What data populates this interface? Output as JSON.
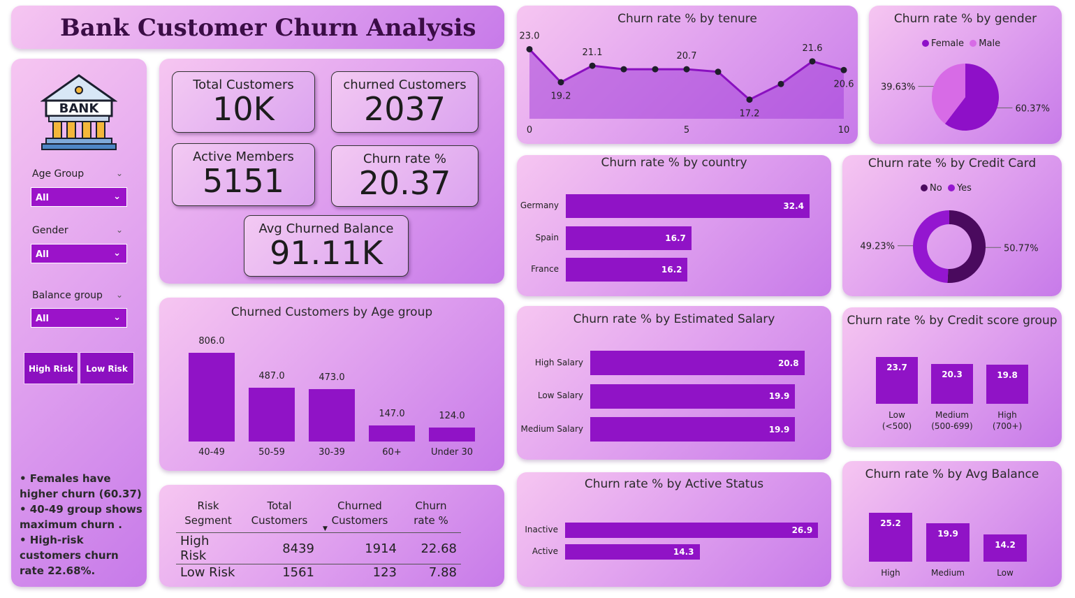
{
  "header": {
    "title": "Bank Customer Churn Analysis"
  },
  "logo": {
    "text": "BANK"
  },
  "slicers": [
    {
      "label": "Age Group",
      "value": "All"
    },
    {
      "label": "Gender",
      "value": "All"
    },
    {
      "label": "Balance group",
      "value": "All"
    }
  ],
  "risk_buttons": {
    "high": "High Risk",
    "low": "Low Risk"
  },
  "insights": [
    "• Females have higher churn (60.37)",
    "• 40-49 group shows maximum churn .",
    "• High-risk customers churn rate 22.68%."
  ],
  "kpis": {
    "total_customers": {
      "label": "Total Customers",
      "value": "10K"
    },
    "churned_customers": {
      "label": "churned Customers",
      "value": "2037"
    },
    "active_members": {
      "label": "Active Members",
      "value": "5151"
    },
    "churn_rate": {
      "label": "Churn rate %",
      "value": "20.37"
    },
    "avg_churned_balance": {
      "label": "Avg Churned Balance",
      "value": "91.11K"
    }
  },
  "risk_table": {
    "columns": [
      "Risk Segment",
      "Total Customers",
      "Churned Customers",
      "Churn rate %"
    ],
    "rows": [
      [
        "High Risk",
        "8439",
        "1914",
        "22.68"
      ],
      [
        "Low Risk",
        "1561",
        "123",
        "7.88"
      ]
    ]
  },
  "colors": {
    "bar": "#9013c6",
    "female": "#8e10c8",
    "male": "#d76be6",
    "no": "#4a0a5e",
    "yes": "#9416d0"
  },
  "chart_data": [
    {
      "id": "tenure",
      "type": "area",
      "title": "Churn rate % by tenure",
      "x": [
        0,
        1,
        2,
        3,
        4,
        5,
        6,
        7,
        8,
        9,
        10
      ],
      "y": [
        23.0,
        19.2,
        21.1,
        20.7,
        20.7,
        20.7,
        20.4,
        17.2,
        19.0,
        21.6,
        20.6
      ],
      "data_labels": {
        "0": "23.0",
        "2": "21.1",
        "1": "19.2",
        "5": "20.7",
        "7": "17.2",
        "9": "21.6",
        "10": "20.6"
      },
      "xticks": [
        "0",
        "5",
        "10"
      ],
      "xlim": [
        0,
        10
      ],
      "ylim": [
        15,
        24
      ]
    },
    {
      "id": "gender",
      "type": "pie",
      "title": "Churn rate % by gender",
      "labels": [
        "Female",
        "Male"
      ],
      "values": [
        60.37,
        39.63
      ],
      "value_labels": [
        "60.37%",
        "39.63%"
      ]
    },
    {
      "id": "country",
      "type": "bar",
      "orientation": "horizontal",
      "title": "Churn rate % by country",
      "categories": [
        "Germany",
        "Spain",
        "France"
      ],
      "values": [
        32.4,
        16.7,
        16.2
      ],
      "xlim": [
        0,
        35
      ]
    },
    {
      "id": "credit_card",
      "type": "pie",
      "variant": "donut",
      "title": "Churn rate % by Credit Card",
      "labels": [
        "No",
        "Yes"
      ],
      "values": [
        50.77,
        49.23
      ],
      "value_labels": [
        "50.77%",
        "49.23%"
      ]
    },
    {
      "id": "age",
      "type": "bar",
      "title": "Churned Customers by Age group",
      "categories": [
        "40-49",
        "50-59",
        "30-39",
        "60+",
        "Under 30"
      ],
      "values": [
        806.0,
        487.0,
        473.0,
        147.0,
        124.0
      ],
      "ylim": [
        0,
        850
      ]
    },
    {
      "id": "salary",
      "type": "bar",
      "orientation": "horizontal",
      "title": "Churn rate % by Estimated Salary",
      "categories": [
        "High Salary",
        "Low Salary",
        "Medium Salary"
      ],
      "values": [
        20.8,
        19.9,
        19.9
      ],
      "xlim": [
        0,
        23
      ]
    },
    {
      "id": "credit_score",
      "type": "bar",
      "title": "Churn rate % by Credit score group",
      "categories": [
        "Low (<500)",
        "Medium (500-699)",
        "High (700+)"
      ],
      "values": [
        23.7,
        20.3,
        19.8
      ],
      "ylim": [
        0,
        26
      ]
    },
    {
      "id": "active",
      "type": "bar",
      "orientation": "horizontal",
      "title": "Churn rate % by Active Status",
      "categories": [
        "Inactive",
        "Active"
      ],
      "values": [
        26.9,
        14.3
      ],
      "xlim": [
        0,
        28
      ]
    },
    {
      "id": "balance",
      "type": "bar",
      "title": "Churn rate % by Avg Balance",
      "categories": [
        "High",
        "Medium",
        "Low"
      ],
      "values": [
        25.2,
        19.9,
        14.2
      ],
      "ylim": [
        0,
        27
      ]
    }
  ]
}
